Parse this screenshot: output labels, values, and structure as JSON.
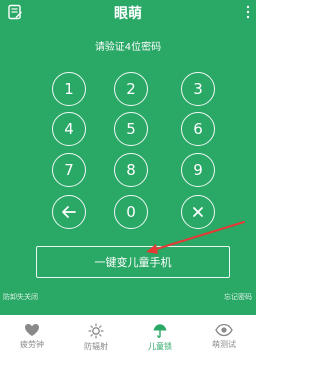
{
  "header": {
    "title": "眼萌"
  },
  "prompt": "请验证4位密码",
  "keypad": {
    "k1": "1",
    "k2": "2",
    "k3": "3",
    "k4": "4",
    "k5": "5",
    "k6": "6",
    "k7": "7",
    "k8": "8",
    "k9": "9",
    "k0": "0",
    "back_icon": "left-arrow-icon",
    "clear_icon": "close-icon"
  },
  "convert_button": "一键变儿童手机",
  "exit_link": "防卸失关闭",
  "forgot_link": "忘记密码",
  "tabs": [
    {
      "label": "疲劳钟",
      "icon": "heart-icon"
    },
    {
      "label": "防辐射",
      "icon": "sun-icon"
    },
    {
      "label": "儿童锁",
      "icon": "umbrella-icon"
    },
    {
      "label": "萌测试",
      "icon": "eye-icon"
    }
  ],
  "colors": {
    "accent": "#2aa866",
    "annotation_arrow": "#e53935",
    "tab_inactive": "#8a8a8a"
  }
}
